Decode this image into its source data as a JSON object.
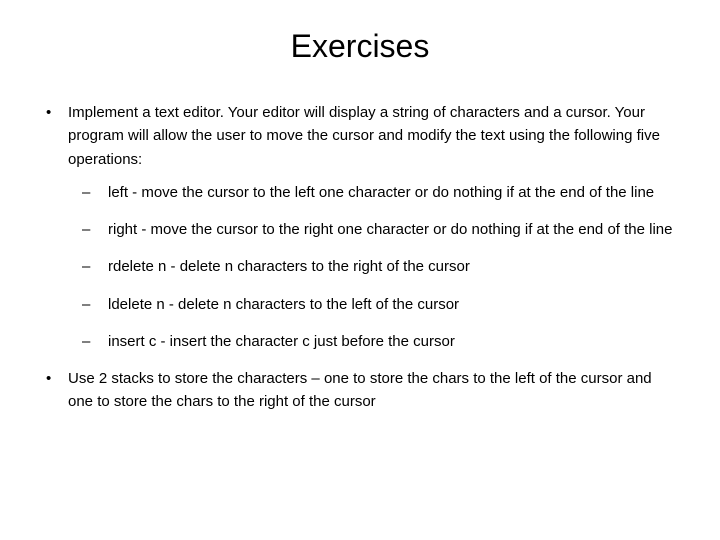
{
  "title": "Exercises",
  "bullets": [
    {
      "text": "Implement a text editor. Your editor will display a string of characters and a cursor. Your program will allow the user to move the cursor and modify the text using the following five operations:",
      "sublist": [
        "left - move the cursor to the left one character or do nothing if at the end of the line",
        "right - move the cursor to the right one character or do nothing if at the end of the line",
        "rdelete n - delete n characters to the right of the cursor",
        "ldelete n - delete n characters to the left of the cursor",
        "insert c - insert the character c just before the cursor"
      ]
    },
    {
      "text": "Use 2 stacks to store the characters – one to store the chars to the left of the cursor and one to store the chars to the right of the cursor",
      "sublist": []
    }
  ]
}
